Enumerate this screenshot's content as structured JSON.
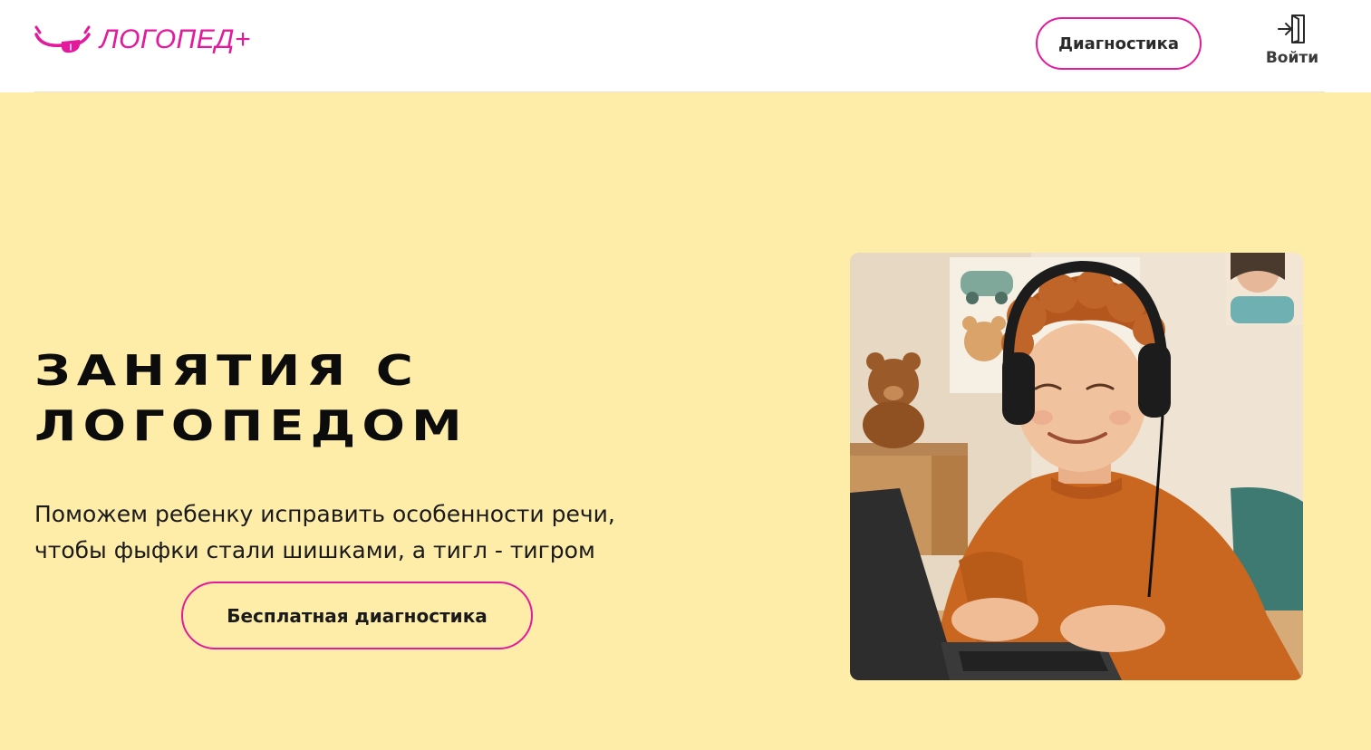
{
  "header": {
    "logo_text": "ЛОГОПЕД+",
    "diagnostics_label": "Диагностика",
    "login_label": "Войти"
  },
  "hero": {
    "title": "Занятия с логопедом",
    "subtitle": "Поможем ребенку исправить особенности речи,\nчтобы фыфки стали шишками, а тигл - тигром",
    "cta_label": "Бесплатная диагностика"
  },
  "icons": {
    "logo": "tongue-smile-icon",
    "login": "sign-in-door-icon"
  },
  "colors": {
    "accent": "#e5199c",
    "hero_background": "#feeca9",
    "header_background": "#ffffff",
    "text_dark": "#0c0c0c"
  }
}
